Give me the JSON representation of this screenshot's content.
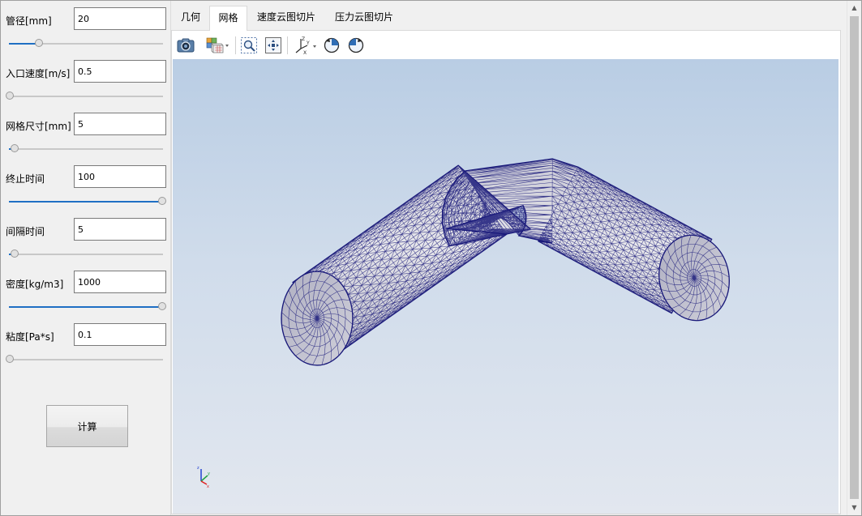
{
  "params": [
    {
      "label": "管径[mm]",
      "value": "20",
      "slider": 0.19
    },
    {
      "label": "入口速度[m/s]",
      "value": "0.5",
      "slider": 0.0
    },
    {
      "label": "网格尺寸[mm]",
      "value": "5",
      "slider": 0.03
    },
    {
      "label": "终止时间",
      "value": "100",
      "slider": 1.0
    },
    {
      "label": "间隔时间",
      "value": "5",
      "slider": 0.03
    },
    {
      "label": "密度[kg/m3]",
      "value": "1000",
      "slider": 1.0
    },
    {
      "label": "粘度[Pa*s]",
      "value": "0.1",
      "slider": 0.0
    }
  ],
  "calc_button": "计算",
  "tabs": [
    {
      "label": "几何",
      "active": false
    },
    {
      "label": "网格",
      "active": true
    },
    {
      "label": "速度云图切片",
      "active": false
    },
    {
      "label": "压力云图切片",
      "active": false
    }
  ],
  "toolbar_icons": [
    "camera-icon",
    "display-mode-icon",
    "zoom-box-icon",
    "fit-view-icon",
    "axes-view-icon",
    "rotate-ccw-icon",
    "rotate-cw-icon"
  ],
  "colors": {
    "mesh_line": "#1a1a7a",
    "mesh_face": "#dedee4",
    "viewport_top": "#b9cde4",
    "viewport_bottom": "#e2e7ef",
    "slider_fill": "#1f6fc4"
  },
  "axis_labels": {
    "z": "z",
    "y": "y",
    "x": "x"
  }
}
